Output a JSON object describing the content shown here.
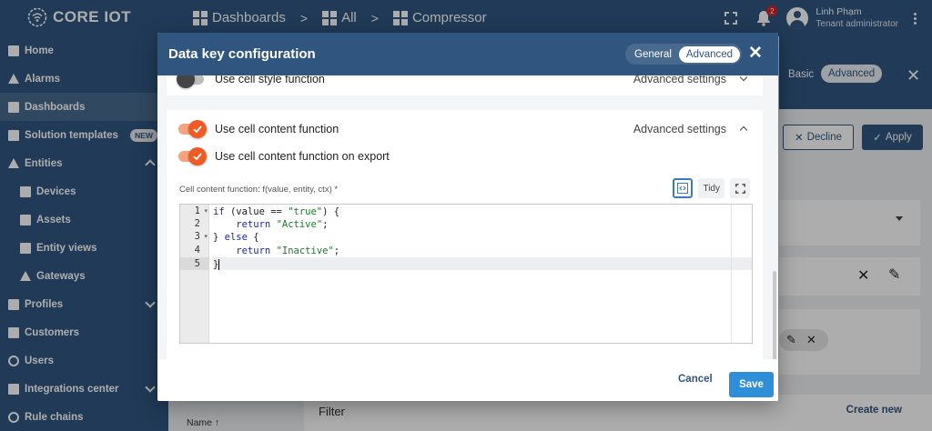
{
  "app": {
    "logo_text": "CORE IOT",
    "breadcrumbs": [
      {
        "label": "Dashboards"
      },
      {
        "label": "All"
      },
      {
        "label": "Compressor"
      }
    ],
    "notifications_count": "2",
    "user": {
      "name": "Linh Phạm",
      "role": "Tenant administrator"
    }
  },
  "sidebar": {
    "items": [
      {
        "label": "Home",
        "icon": "home-icon"
      },
      {
        "label": "Alarms",
        "icon": "alarm-icon"
      },
      {
        "label": "Dashboards",
        "icon": "dashboard-icon"
      },
      {
        "label": "Solution templates",
        "icon": "templates-icon",
        "badge": "NEW"
      },
      {
        "label": "Entities",
        "icon": "entities-icon"
      },
      {
        "label": "Devices",
        "icon": "devices-icon"
      },
      {
        "label": "Assets",
        "icon": "assets-icon"
      },
      {
        "label": "Entity views",
        "icon": "entity-views-icon"
      },
      {
        "label": "Gateways",
        "icon": "gateways-icon"
      },
      {
        "label": "Profiles",
        "icon": "profiles-icon"
      },
      {
        "label": "Customers",
        "icon": "customers-icon"
      },
      {
        "label": "Users",
        "icon": "users-icon"
      },
      {
        "label": "Integrations center",
        "icon": "integrations-icon"
      },
      {
        "label": "Rule chains",
        "icon": "rule-chains-icon"
      }
    ]
  },
  "background": {
    "basic_label": "Basic",
    "advanced_label": "Advanced",
    "decline_label": "Decline",
    "apply_label": "Apply",
    "filter_label": "Filter",
    "create_new_label": "Create new",
    "name_column": "Name ↑"
  },
  "dialog": {
    "title": "Data key configuration",
    "tabs": [
      {
        "label": "General",
        "active": false
      },
      {
        "label": "Advanced",
        "active": true
      }
    ],
    "cell_style": {
      "label": "Use cell style function",
      "enabled": false,
      "settings_label": "Advanced settings"
    },
    "cell_content": {
      "label": "Use cell content function",
      "enabled": true,
      "settings_label": "Advanced settings"
    },
    "cell_content_export": {
      "label": "Use cell content function on export",
      "enabled": true
    },
    "function_label": "Cell content function: f(value, entity, ctx) *",
    "tidy_label": "Tidy",
    "code_lines": [
      {
        "n": "1",
        "text": "if (value == \"true\") {"
      },
      {
        "n": "2",
        "text": "    return \"Active\";"
      },
      {
        "n": "3",
        "text": "} else {"
      },
      {
        "n": "4",
        "text": "    return \"Inactive\";"
      },
      {
        "n": "5",
        "text": "}"
      }
    ],
    "cancel_label": "Cancel",
    "save_label": "Save"
  },
  "colors": {
    "primary": "#305680",
    "accent_toggle": "#ef5a25",
    "save_button": "#2e8ed8"
  }
}
